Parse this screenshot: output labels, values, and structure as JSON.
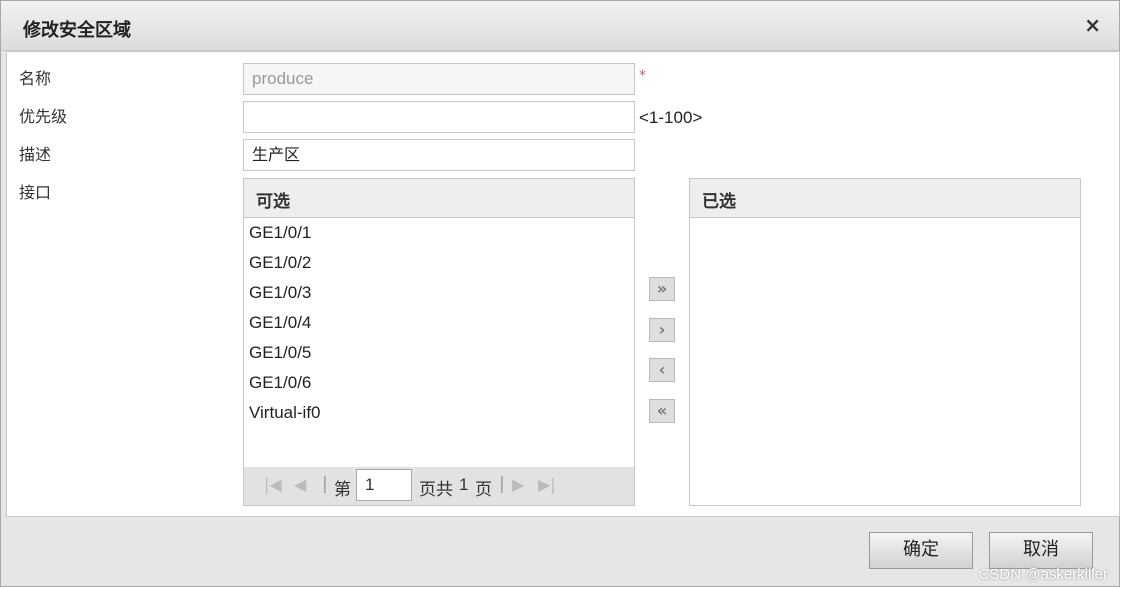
{
  "dialog": {
    "title": "修改安全区域",
    "close_glyph": "×"
  },
  "form": {
    "name_label": "名称",
    "name_value": "produce",
    "required_mark": "*",
    "priority_label": "优先级",
    "priority_value": "",
    "priority_hint": "<1-100>",
    "desc_label": "描述",
    "desc_value": "生产区",
    "interface_label": "接口"
  },
  "available": {
    "header": "可选",
    "items": [
      "GE1/0/1",
      "GE1/0/2",
      "GE1/0/3",
      "GE1/0/4",
      "GE1/0/5",
      "GE1/0/6",
      "Virtual-if0"
    ]
  },
  "selected": {
    "header": "已选",
    "items": []
  },
  "pager": {
    "prefix": "第",
    "page": "1",
    "suffix_a": "页共",
    "total": "1",
    "suffix_b": "页"
  },
  "move_buttons": {
    "all_right": "»",
    "right": "›",
    "left": "‹",
    "all_left": "«"
  },
  "footer": {
    "ok_label": "确定",
    "cancel_label": "取消"
  },
  "watermark": "CSDN @askerkiller"
}
